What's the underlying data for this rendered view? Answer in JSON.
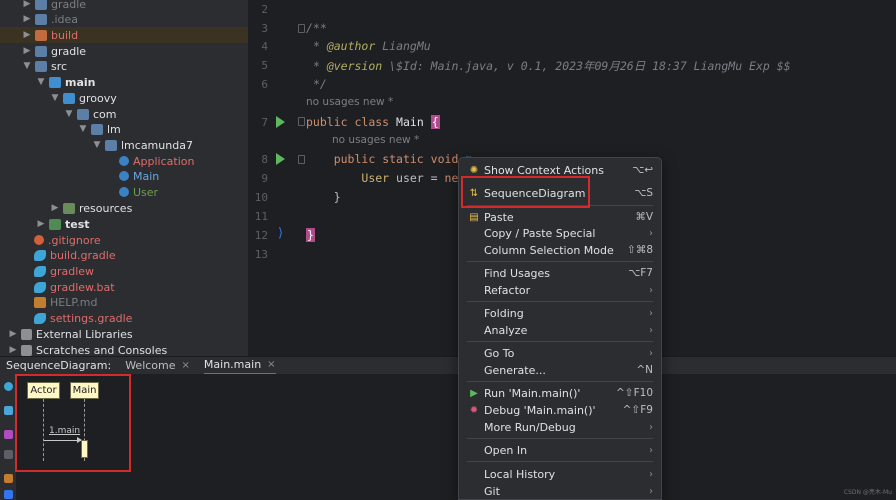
{
  "colors": {
    "accent": "#3574f0",
    "highlight_frame": "#d42a2a",
    "run_green": "#5fb85f"
  },
  "tree": {
    "items": [
      {
        "label": "gradle",
        "cls": "t-dim",
        "icon": "folder-icon"
      },
      {
        "label": ".idea",
        "cls": "t-dim",
        "icon": "folder-icon"
      },
      {
        "label": "build",
        "cls": "t-red",
        "icon": "folder-icon"
      },
      {
        "label": "gradle",
        "cls": "t-white",
        "icon": "folder-icon"
      },
      {
        "label": "src",
        "cls": "t-white",
        "icon": "folder-icon"
      },
      {
        "label": "main",
        "cls": "bold",
        "icon": "folder-icon"
      },
      {
        "label": "groovy",
        "cls": "t-white",
        "icon": "folder-icon"
      },
      {
        "label": "com",
        "cls": "t-white",
        "icon": "folder-icon"
      },
      {
        "label": "lm",
        "cls": "t-white",
        "icon": "folder-icon"
      },
      {
        "label": "lmcamunda7",
        "cls": "t-white",
        "icon": "folder-icon"
      },
      {
        "label": "Application",
        "cls": "t-red",
        "icon": "class-icon"
      },
      {
        "label": "Main",
        "cls": "t-blue",
        "icon": "class-icon"
      },
      {
        "label": "User",
        "cls": "t-green",
        "icon": "class-icon"
      },
      {
        "label": "resources",
        "cls": "t-white",
        "icon": "folder-icon"
      },
      {
        "label": "test",
        "cls": "bold",
        "icon": "folder-icon"
      },
      {
        "label": ".gitignore",
        "cls": "t-red",
        "icon": "git-icon"
      },
      {
        "label": "build.gradle",
        "cls": "t-red",
        "icon": "gradle-icon"
      },
      {
        "label": "gradlew",
        "cls": "t-red",
        "icon": "gradle-icon"
      },
      {
        "label": "gradlew.bat",
        "cls": "t-red",
        "icon": "gradle-icon"
      },
      {
        "label": "HELP.md",
        "cls": "t-dim",
        "icon": "markdown-icon"
      },
      {
        "label": "settings.gradle",
        "cls": "t-red",
        "icon": "gradle-icon"
      },
      {
        "label": "External Libraries",
        "cls": "t-white",
        "icon": "library-icon"
      },
      {
        "label": "Scratches and Consoles",
        "cls": "t-white",
        "icon": "scratch-icon"
      }
    ]
  },
  "editor": {
    "line_numbers": [
      "2",
      "3",
      "4",
      "5",
      "6",
      "7",
      "8",
      "9",
      "10",
      "11",
      "12",
      "13"
    ],
    "comment_open": "/**",
    "author_tag": "@author",
    "author_name": "LiangMu",
    "version_tag": "@version",
    "version_text": "\\$Id: Main.java, v 0.1, 2023年09月26日 18:37 LiangMu Exp $$",
    "comment_close": "*/",
    "hint_class": "no usages  new *",
    "hint_method": "no usages  new *",
    "kw_public": "public",
    "kw_class": "class",
    "class_name": "Main",
    "brace_open": "{",
    "kw_static": "static",
    "kw_void": "void",
    "method_name": "m",
    "type_user": "User",
    "var_user": "user",
    "op_assign": "=",
    "kw_new": "new",
    "brace_close_inner": "}",
    "brace_close": "}",
    "star": "*"
  },
  "tool_window": {
    "title": "SequenceDiagram:",
    "tabs": [
      {
        "label": "Welcome",
        "closable": true
      },
      {
        "label": "Main.main",
        "closable": true
      }
    ],
    "close_glyph": "×"
  },
  "sequence": {
    "actor": "Actor",
    "participant": "Main",
    "message": "1.main"
  },
  "menu": {
    "items": [
      {
        "label": "Show Context Actions",
        "shortcut": "⌥↩",
        "icon": "bulb-icon",
        "sub": false
      },
      {
        "label": "SequenceDiagram",
        "shortcut": "⌥S",
        "icon": "sequence-icon",
        "sub": false
      },
      {
        "label": "Paste",
        "shortcut": "⌘V",
        "icon": "clipboard-icon",
        "sub": false
      },
      {
        "label": "Copy / Paste Special",
        "shortcut": "",
        "icon": "",
        "sub": true
      },
      {
        "label": "Column Selection Mode",
        "shortcut": "⇧⌘8",
        "icon": "",
        "sub": false
      },
      {
        "label": "Find Usages",
        "shortcut": "⌥F7",
        "icon": "",
        "sub": false
      },
      {
        "label": "Refactor",
        "shortcut": "",
        "icon": "",
        "sub": true
      },
      {
        "label": "Folding",
        "shortcut": "",
        "icon": "",
        "sub": true
      },
      {
        "label": "Analyze",
        "shortcut": "",
        "icon": "",
        "sub": true
      },
      {
        "label": "Go To",
        "shortcut": "",
        "icon": "",
        "sub": true
      },
      {
        "label": "Generate...",
        "shortcut": "^N",
        "icon": "",
        "sub": false
      },
      {
        "label": "Run 'Main.main()'",
        "shortcut": "^⇧F10",
        "icon": "run-icon",
        "sub": false
      },
      {
        "label": "Debug 'Main.main()'",
        "shortcut": "^⇧F9",
        "icon": "debug-icon",
        "sub": false
      },
      {
        "label": "More Run/Debug",
        "shortcut": "",
        "icon": "",
        "sub": true
      },
      {
        "label": "Open In",
        "shortcut": "",
        "icon": "",
        "sub": true
      },
      {
        "label": "Local History",
        "shortcut": "",
        "icon": "",
        "sub": true
      },
      {
        "label": "Git",
        "shortcut": "",
        "icon": "",
        "sub": true
      }
    ],
    "submenu_glyph": "›"
  },
  "watermark": "CSDN @亮木-Mu"
}
